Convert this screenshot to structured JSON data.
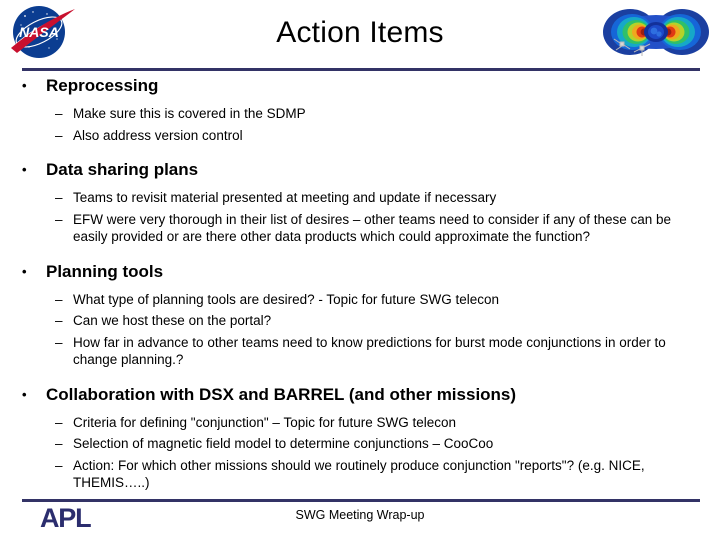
{
  "header": {
    "title": "Action Items",
    "nasa_logo_alt": "NASA",
    "nasa_wordmark": "NASA",
    "belt_logo_alt": "Van Allen radiation belts visualization"
  },
  "colors": {
    "rule": "#333366",
    "nasa_blue": "#0b3d91",
    "nasa_red": "#c8102e",
    "apl_navy": "#2b2d6e",
    "text": "#000000",
    "background": "#ffffff"
  },
  "content": {
    "bullet_glyph": "•",
    "dash_glyph": "–",
    "groups": [
      {
        "heading": "Reprocessing",
        "subs": [
          "Make sure this is covered in the SDMP",
          "Also address version control"
        ]
      },
      {
        "heading": "Data sharing plans",
        "subs": [
          "Teams to revisit material presented at meeting and update if necessary",
          "EFW were very thorough in their list of desires – other teams need to consider if any of these can be easily provided or are there other data products which could approximate the function?"
        ]
      },
      {
        "heading": "Planning tools",
        "subs": [
          "What type of planning tools are desired? - Topic for future SWG telecon",
          "Can we host these on the portal?",
          "How far in advance to other teams need to know predictions for burst mode conjunctions in order to change planning.?"
        ]
      },
      {
        "heading": "Collaboration with DSX and BARREL (and other missions)",
        "subs": [
          "Criteria for defining \"conjunction\" – Topic for future SWG telecon",
          "Selection of magnetic field model to determine conjunctions – CooCoo",
          "Action: For which other missions should we routinely produce conjunction \"reports\"? (e.g. NICE, THEMIS…..)"
        ]
      }
    ]
  },
  "footer": {
    "text": "SWG Meeting Wrap-up",
    "apl_logo_text": "APL"
  }
}
